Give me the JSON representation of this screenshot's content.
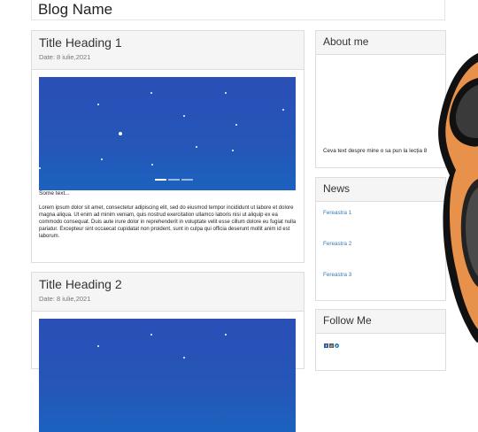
{
  "header": {
    "blog_name": "Blog Name"
  },
  "posts": [
    {
      "title": "Title Heading 1",
      "date": "Date: 8 iulie,2021",
      "caption": "Some text...",
      "body": "Lorem ipsum dolor sit amet, consectetur adipiscing elit, sed do eiusmod tempor incididunt ut labore et dolore magna aliqua. Ut enim ad minim veniam, quis nostrud exercitation ullamco laboris nisi ut aliquip ex ea commodo consequat. Duis aute irure dolor in reprehenderit in voluptate velit esse cillum dolore eu fugiat nulla pariatur. Excepteur sint occaecat cupidatat non proident, sunt in culpa qui officia deserunt mollit anim id est laborum."
    },
    {
      "title": "Title Heading 2",
      "date": "Date: 8 iulie,2021"
    }
  ],
  "sidebar": {
    "about": {
      "title": "About me",
      "text": "Ceva text despre mine o sa pun la lecția 8"
    },
    "news": {
      "title": "News",
      "items": [
        "Fereastra 1",
        "Fereastra 2",
        "Fereastra 3"
      ]
    },
    "follow": {
      "title": "Follow Me",
      "icons": [
        "facebook-icon",
        "instagram-icon",
        "telegram-icon"
      ]
    }
  },
  "colors": {
    "link": "#337ab7",
    "carousel": "#2556b8"
  }
}
